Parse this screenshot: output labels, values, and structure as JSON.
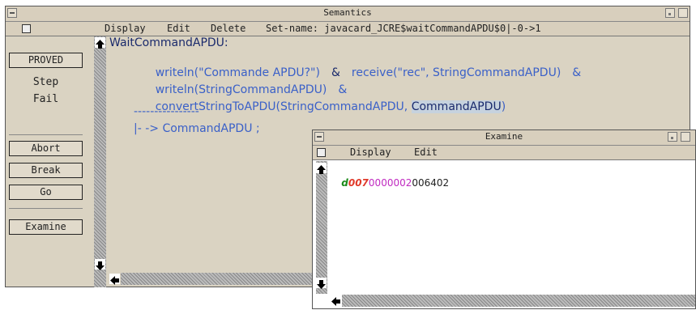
{
  "semantics_window": {
    "title": "Semantics",
    "menu": {
      "display": "Display",
      "edit": "Edit",
      "delete": "Delete",
      "setname": "Set-name: javacard_JCRE$waitCommandAPDU$0|-0->1"
    },
    "status": {
      "proved": "PROVED",
      "step": "Step",
      "fail": "Fail"
    },
    "buttons": {
      "abort": "Abort",
      "break": "Break",
      "go": "Go",
      "examine": "Examine"
    },
    "code": {
      "line1": "WaitCommandAPDU:",
      "line2a": "writeln(\"Commande APDU?\")",
      "line2b": "&",
      "line2c": "receive(\"rec\", StringCommandAPDU)",
      "line2d": "&",
      "line3a": "writeln(StringCommandAPDU)",
      "line3b": "&",
      "line4a": "convertStringToAPDU(StringCommandAPDU, ",
      "line4b": "CommandAPDU",
      "line4c": ")",
      "line5": "----------------",
      "line6": "|- -> CommandAPDU ;"
    }
  },
  "examine_window": {
    "title": "Examine",
    "menu": {
      "display": "Display",
      "edit": "Edit"
    },
    "value": {
      "seg1": "d",
      "seg2": "007",
      "seg3": "0000002",
      "seg4": "006402"
    }
  },
  "colors": {
    "window_bg": "#dad3c2",
    "code_blue": "#3a60c8",
    "code_dark": "#1a2a6c",
    "value_green": "#1a8a1a",
    "value_red": "#e03a2a",
    "value_magenta": "#c02ac0"
  }
}
